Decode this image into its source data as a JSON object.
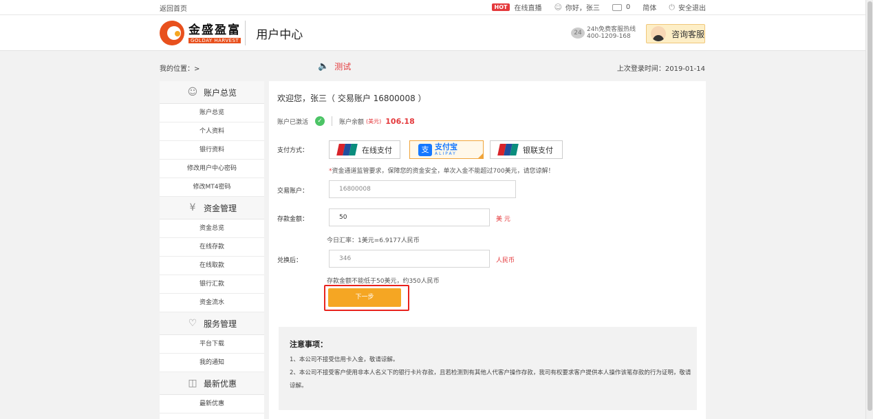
{
  "topbar": {
    "back_home": "返回首页",
    "hot_badge": "HOT",
    "live": "在线直播",
    "greeting": "你好，张三",
    "messages_count": "0",
    "language": "简体",
    "logout": "安全退出"
  },
  "header": {
    "logo_cn": "金盛盈富",
    "logo_en": "GOLDAY HARVEST",
    "page_title": "用户中心",
    "hotline_label": "24h免费客服热线",
    "hotline_number": "400-1209-168",
    "hotline_badge": "24",
    "consult_label": "咨询客服"
  },
  "location": {
    "label": "我的位置：>",
    "notice": "测试",
    "last_login": "上次登录时间：2019-01-14"
  },
  "sidebar": {
    "groups": [
      {
        "title": "账户总览",
        "items": [
          "账户总览",
          "个人资料",
          "银行资料",
          "修改用户中心密码",
          "修改MT4密码"
        ]
      },
      {
        "title": "资金管理",
        "items": [
          "资金总览",
          "在线存款",
          "在线取款",
          "银行汇款",
          "资金流水"
        ]
      },
      {
        "title": "服务管理",
        "items": [
          "平台下载",
          "我的通知"
        ]
      },
      {
        "title": "最新优惠",
        "items": [
          "最新优惠"
        ]
      }
    ]
  },
  "main": {
    "welcome": "欢迎您，张三（ 交易账户 16800008 ）",
    "activated": "账户已激活",
    "balance_label": "账户余额",
    "balance_unit": "(美元)",
    "balance_value": "106.18",
    "pay_label": "支付方式：",
    "pay_options": {
      "online": "在线支付",
      "alipay_cn": "支付宝",
      "alipay_en": "ALIPAY",
      "unionpay": "银联支付"
    },
    "unionpay_mark": "UnionPay 银联",
    "warning_star": "*",
    "warning": "资金通道监管要求，保障您的资金安全，单次入金不能超过700美元，请您谅解！",
    "account_label": "交易账户：",
    "account_value": "16800008",
    "amount_label": "存款金额：",
    "amount_value": "50",
    "amount_unit": "美 元",
    "rate": "今日汇率：1美元=6.9177人民币",
    "converted_label": "兑换后：",
    "converted_value": "346",
    "converted_unit": "人民币",
    "min_hint": "存款金额不能低于50美元，约350人民币",
    "next_button": "下一步"
  },
  "notes": {
    "title": "注意事项：",
    "lines": [
      "1、本公司不接受信用卡入金，敬请谅解。",
      "2、本公司不接受客户使用非本人名义下的银行卡片存款，且若检测到有其他人代客户操作存款，我司有权要求客户提供本人操作该笔存款的行为证明，敬请谅解。"
    ]
  },
  "colors": {
    "accent": "#f5a623",
    "alert": "#e4393c",
    "success": "#4cc466"
  }
}
